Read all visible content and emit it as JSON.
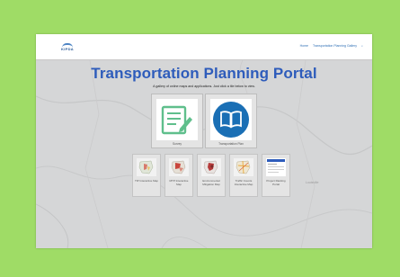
{
  "header": {
    "logo_text": "KIPDA",
    "nav": [
      "Home",
      "Transportation Planning Gallery",
      "⌕"
    ]
  },
  "main": {
    "title": "Transportation Planning Portal",
    "subtitle": "A gallery of online maps and applications. Just click a tile below to view.",
    "featured": [
      {
        "label": "Survey",
        "icon": "document-edit-icon"
      },
      {
        "label": "Transportation Plan",
        "icon": "book-icon"
      }
    ],
    "maps": [
      {
        "label": "TIP Interactive Map",
        "thumb": "regional-map-thumbnail"
      },
      {
        "label": "MTP Interactive Map",
        "thumb": "regional-map-thumbnail"
      },
      {
        "label": "Environmental Mitigation Map",
        "thumb": "regional-map-thumbnail"
      },
      {
        "label": "Traffic Counts Interactive Map",
        "thumb": "regional-map-thumbnail"
      },
      {
        "label": "Project Ranking Portal",
        "thumb": "app-screenshot-thumbnail"
      }
    ]
  },
  "basemap": {
    "place_label": "Louisville"
  },
  "colors": {
    "background": "#9fdc66",
    "title": "#2e5cbb",
    "icon_green": "#5fbf8c",
    "icon_blue": "#1a6fb5",
    "map_tint": "#d5d6d7"
  }
}
